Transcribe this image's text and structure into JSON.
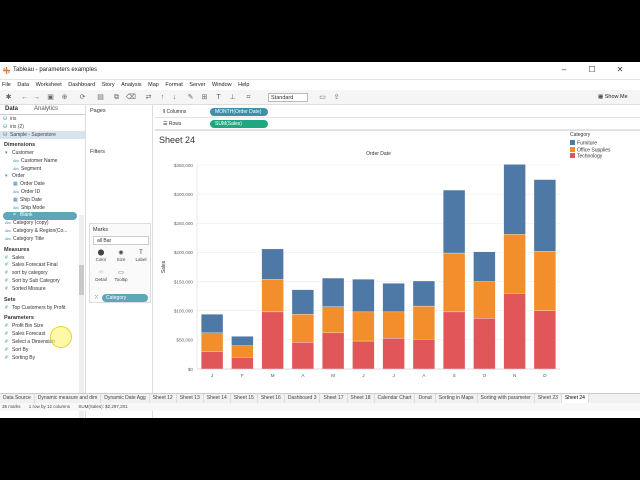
{
  "window": {
    "title": "Tableau - parameters examples"
  },
  "menu": [
    "File",
    "Data",
    "Worksheet",
    "Dashboard",
    "Story",
    "Analysis",
    "Map",
    "Format",
    "Server",
    "Window",
    "Help"
  ],
  "toolbar": {
    "view_select": "Standard",
    "show_me": "Show Me"
  },
  "data_pane": {
    "tab_data": "Data",
    "tab_analytics": "Analytics",
    "sources": [
      "iris",
      "iris (2)",
      "Sample - Superstore"
    ],
    "dimensions_header": "Dimensions",
    "dimensions": [
      {
        "label": "Customer",
        "level": 0,
        "glyph": "▾"
      },
      {
        "label": "Customer Name",
        "level": 1,
        "glyph": "Abc"
      },
      {
        "label": "Segment",
        "level": 1,
        "glyph": "Abc"
      },
      {
        "label": "Order",
        "level": 0,
        "glyph": "▾"
      },
      {
        "label": "Order Date",
        "level": 1,
        "glyph": "▦"
      },
      {
        "label": "Order ID",
        "level": 1,
        "glyph": "Abc"
      },
      {
        "label": "Ship Date",
        "level": 1,
        "glyph": "▦"
      },
      {
        "label": "Ship Mode",
        "level": 1,
        "glyph": "Abc"
      },
      {
        "label": "Blank",
        "level": 0,
        "glyph": "=",
        "selected": true
      },
      {
        "label": "Category (copy)",
        "level": 0,
        "glyph": "Abc"
      },
      {
        "label": "Category & Region(Co...",
        "level": 0,
        "glyph": "Abc"
      },
      {
        "label": "Category Title",
        "level": 0,
        "glyph": "Abc"
      }
    ],
    "measures_header": "Measures",
    "measures": [
      "Sales",
      "Sales Forecast Final",
      "sort by category",
      "Sort by Sub Category",
      "Sorted Missure"
    ],
    "sets_header": "Sets",
    "sets": [
      "Top Customers by Profit"
    ],
    "parameters_header": "Parameters",
    "parameters": [
      "Profit Bin Size",
      "Sales Forecast",
      "Select a Dimension",
      "Sort By",
      "Sorting By"
    ]
  },
  "cards": {
    "pages": "Pages",
    "filters": "Filters",
    "marks": "Marks",
    "mark_type": "all Bar",
    "buttons": [
      "Color",
      "Size",
      "Label",
      "Detail",
      "Tooltip"
    ],
    "color_pill": "Category"
  },
  "shelves": {
    "columns_label": "Columns",
    "columns_pill": "MONTH(Order Date)",
    "rows_label": "Rows",
    "rows_pill": "SUM(Sales)"
  },
  "sheet": {
    "title": "Sheet 24"
  },
  "legend": {
    "title": "Category",
    "items": [
      {
        "label": "Furniture",
        "color": "#4e79a7"
      },
      {
        "label": "Office Supplies",
        "color": "#f28e2b"
      },
      {
        "label": "Technology",
        "color": "#e15759"
      }
    ]
  },
  "chart_data": {
    "type": "bar",
    "stacked": true,
    "title": "Order Date",
    "ylabel": "Sales",
    "ylim": [
      0,
      350000
    ],
    "yticks": [
      "$0",
      "$50,000",
      "$100,000",
      "$150,000",
      "$200,000",
      "$250,000",
      "$300,000",
      "$350,000"
    ],
    "categories": [
      "J",
      "F",
      "M",
      "A",
      "M",
      "J",
      "J",
      "A",
      "S",
      "O",
      "N",
      "D"
    ],
    "series": [
      {
        "name": "Technology",
        "color": "#e15759",
        "values": [
          30000,
          20000,
          98000,
          46000,
          62000,
          48000,
          53000,
          51000,
          98000,
          87000,
          130000,
          100000
        ]
      },
      {
        "name": "Office Supplies",
        "color": "#f28e2b",
        "values": [
          32000,
          20000,
          56000,
          48000,
          45000,
          50000,
          45000,
          57000,
          101000,
          63000,
          101000,
          102000
        ]
      },
      {
        "name": "Furniture",
        "color": "#4e79a7",
        "values": [
          32000,
          16000,
          52000,
          42000,
          49000,
          56000,
          49000,
          43000,
          108000,
          51000,
          120000,
          123000
        ]
      }
    ],
    "grid": true
  },
  "sheet_tabs": [
    "Data Source",
    "Dynamic measure and dim",
    "Dynamic Date Agg",
    "Sheet 12",
    "Sheet 13",
    "Sheet 14",
    "Sheet 15",
    "Sheet 16",
    "Dashboard 3",
    "Sheet 17",
    "Sheet 18",
    "Calendar Chart",
    "Donut",
    "Sorting in Maps",
    "Sorting with parameter",
    "Sheet 23",
    "Sheet 24"
  ],
  "status": {
    "marks": "36 marks",
    "rows": "1 row by 12 columns",
    "sum": "SUM(Sales): $2,297,201"
  }
}
